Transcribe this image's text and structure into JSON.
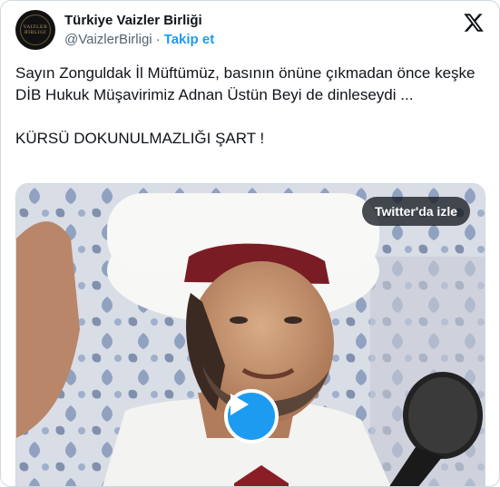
{
  "author": {
    "display_name": "Türkiye Vaizler Birliği",
    "handle": "@VaizlerBirligi",
    "follow_label": "Takip et",
    "avatar_text": [
      "VAIZLER",
      "BIRLIGI"
    ]
  },
  "tweet": {
    "paragraph1": "Sayın Zonguldak İl Müftümüz, basının önüne çıkmadan önce keşke DİB Hukuk Müşavirimiz Adnan Üstün Beyi de dinleseydi ...",
    "paragraph2": "KÜRSÜ DOKUNULMAZLIĞI ŞART !"
  },
  "media": {
    "watch_label": "Twitter'da izle",
    "play_icon": "play-icon"
  },
  "colors": {
    "accent": "#1d9bf0",
    "text": "#0f1419",
    "muted": "#536471"
  }
}
